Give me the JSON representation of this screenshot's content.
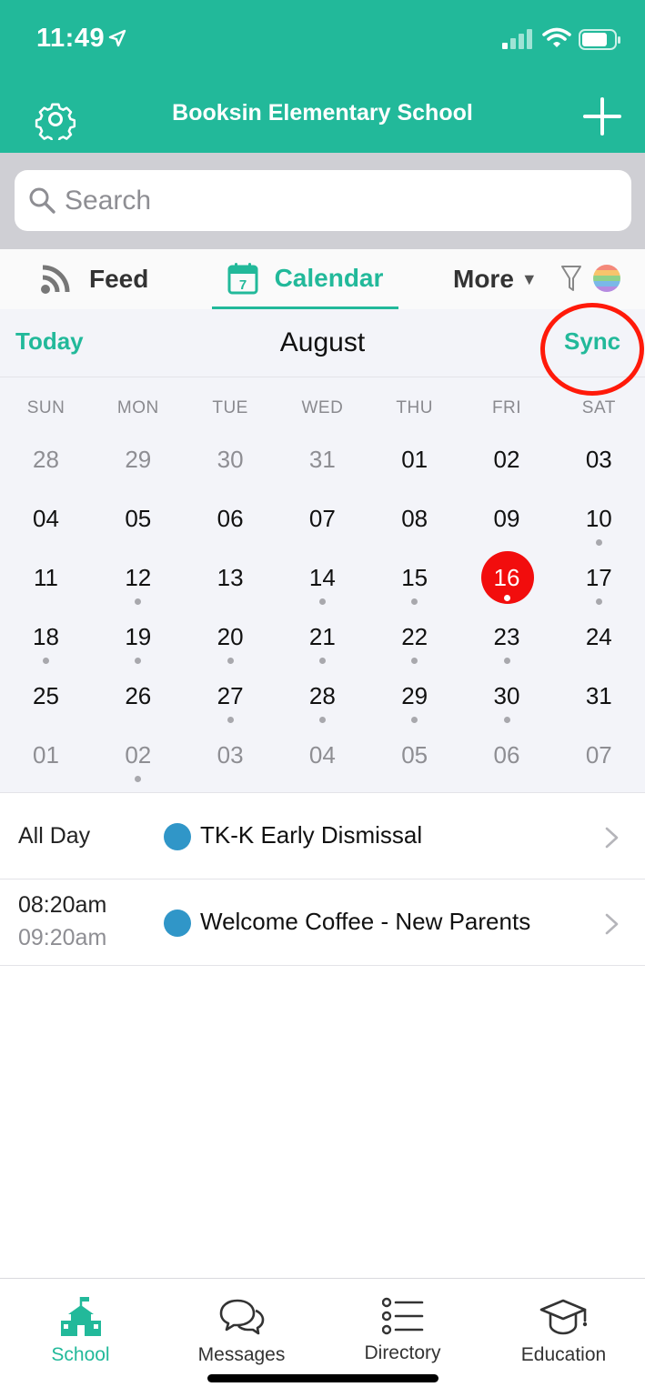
{
  "status_bar": {
    "time": "11:49"
  },
  "header": {
    "title": "Booksin Elementary School"
  },
  "search": {
    "placeholder": "Search"
  },
  "tabs": [
    {
      "label": "Feed",
      "icon": "rss-icon"
    },
    {
      "label": "Calendar",
      "icon": "calendar-icon",
      "icon_text": "7",
      "active": true
    },
    {
      "label": "More",
      "icon": "caret-down-icon"
    }
  ],
  "calendar": {
    "today_label": "Today",
    "month": "August",
    "sync_label": "Sync",
    "weekdays": [
      "SUN",
      "MON",
      "TUE",
      "WED",
      "THU",
      "FRI",
      "SAT"
    ],
    "weeks": [
      [
        {
          "d": "28",
          "muted": true
        },
        {
          "d": "29",
          "muted": true
        },
        {
          "d": "30",
          "muted": true
        },
        {
          "d": "31",
          "muted": true
        },
        {
          "d": "01"
        },
        {
          "d": "02"
        },
        {
          "d": "03"
        }
      ],
      [
        {
          "d": "04"
        },
        {
          "d": "05"
        },
        {
          "d": "06"
        },
        {
          "d": "07"
        },
        {
          "d": "08"
        },
        {
          "d": "09"
        },
        {
          "d": "10",
          "dot": true
        }
      ],
      [
        {
          "d": "11"
        },
        {
          "d": "12",
          "dot": true
        },
        {
          "d": "13"
        },
        {
          "d": "14",
          "dot": true
        },
        {
          "d": "15",
          "dot": true
        },
        {
          "d": "16",
          "dot": true,
          "selected": true
        },
        {
          "d": "17",
          "dot": true
        }
      ],
      [
        {
          "d": "18",
          "dot": true
        },
        {
          "d": "19",
          "dot": true
        },
        {
          "d": "20",
          "dot": true
        },
        {
          "d": "21",
          "dot": true
        },
        {
          "d": "22",
          "dot": true
        },
        {
          "d": "23",
          "dot": true
        },
        {
          "d": "24"
        }
      ],
      [
        {
          "d": "25"
        },
        {
          "d": "26"
        },
        {
          "d": "27",
          "dot": true
        },
        {
          "d": "28",
          "dot": true
        },
        {
          "d": "29",
          "dot": true
        },
        {
          "d": "30",
          "dot": true
        },
        {
          "d": "31"
        }
      ],
      [
        {
          "d": "01",
          "muted": true
        },
        {
          "d": "02",
          "muted": true,
          "dot": true
        },
        {
          "d": "03",
          "muted": true
        },
        {
          "d": "04",
          "muted": true
        },
        {
          "d": "05",
          "muted": true
        },
        {
          "d": "06",
          "muted": true
        },
        {
          "d": "07",
          "muted": true
        }
      ]
    ]
  },
  "events": [
    {
      "time": "All Day",
      "title": "TK-K Early Dismissal",
      "color": "#3096c8"
    },
    {
      "time": "08:20am",
      "end_time": "09:20am",
      "title": "Welcome Coffee - New Parents",
      "color": "#3096c8"
    }
  ],
  "tabbar": [
    {
      "label": "School",
      "icon": "school-icon",
      "active": true
    },
    {
      "label": "Messages",
      "icon": "messages-icon"
    },
    {
      "label": "Directory",
      "icon": "directory-icon"
    },
    {
      "label": "Education",
      "icon": "graduation-cap-icon"
    }
  ],
  "colors": {
    "accent": "#22b99a",
    "selected_day": "#f20d0d",
    "event_dot": "#3096c8",
    "annotation": "#ff1a0a"
  }
}
